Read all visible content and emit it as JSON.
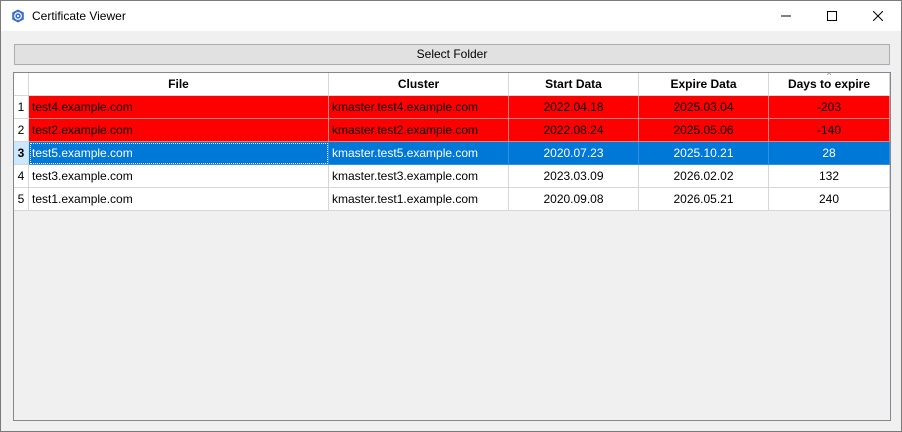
{
  "window": {
    "title": "Certificate Viewer"
  },
  "toolbar": {
    "select_folder_label": "Select Folder"
  },
  "table": {
    "columns": [
      "File",
      "Cluster",
      "Start Data",
      "Expire Data",
      "Days to expire"
    ],
    "sorted_column": "Days to expire",
    "selected_row": 3,
    "rows": [
      {
        "num": "1",
        "file": "test4.example.com",
        "cluster": "kmaster.test4.example.com",
        "start": "2022.04.18",
        "expire": "2025.03.04",
        "days": "-203",
        "status": "expired"
      },
      {
        "num": "2",
        "file": "test2.example.com",
        "cluster": "kmaster.test2.example.com",
        "start": "2022.08.24",
        "expire": "2025.05.06",
        "days": "-140",
        "status": "expired"
      },
      {
        "num": "3",
        "file": "test5.example.com",
        "cluster": "kmaster.test5.example.com",
        "start": "2020.07.23",
        "expire": "2025.10.21",
        "days": "28",
        "status": "selected"
      },
      {
        "num": "4",
        "file": "test3.example.com",
        "cluster": "kmaster.test3.example.com",
        "start": "2023.03.09",
        "expire": "2026.02.02",
        "days": "132",
        "status": "normal"
      },
      {
        "num": "5",
        "file": "test1.example.com",
        "cluster": "kmaster.test1.example.com",
        "start": "2020.09.08",
        "expire": "2026.05.21",
        "days": "240",
        "status": "normal"
      }
    ]
  },
  "colors": {
    "expired": "#ff0000",
    "selected": "#0078d7",
    "normal": "#ffffff"
  },
  "icons": {
    "app": "certificate-app-icon",
    "minimize": "minimize-icon",
    "maximize": "maximize-icon",
    "close": "close-icon"
  }
}
